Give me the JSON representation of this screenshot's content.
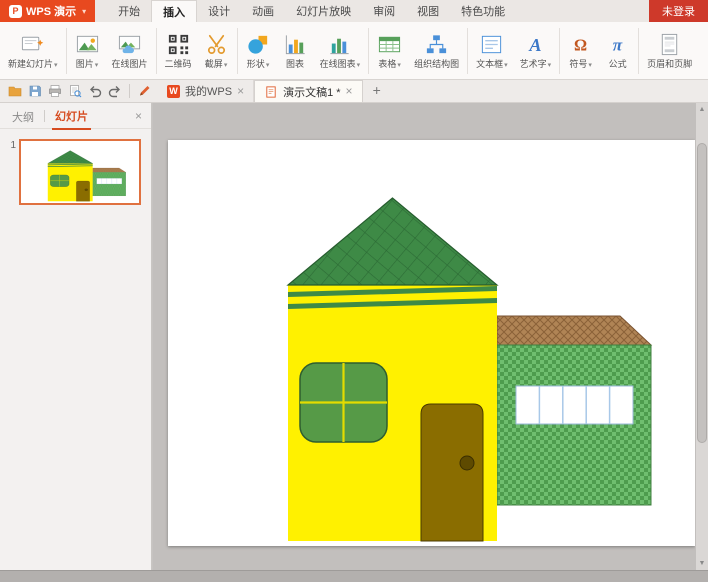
{
  "titlebar": {
    "logo_text": "WPS 演示",
    "login_label": "未登录"
  },
  "icons": {
    "logo_badge": "P",
    "wps_tab_badge": "W",
    "symbol_glyph": "Ω",
    "formula_glyph": "π",
    "wordart_glyph": "A"
  },
  "menu": {
    "active": "插入",
    "items": [
      {
        "label": "开始"
      },
      {
        "label": "插入"
      },
      {
        "label": "设计"
      },
      {
        "label": "动画"
      },
      {
        "label": "幻灯片放映"
      },
      {
        "label": "审阅"
      },
      {
        "label": "视图"
      },
      {
        "label": "特色功能"
      }
    ]
  },
  "ribbon": {
    "buttons": [
      {
        "label": "新建幻灯片",
        "dropdown": true
      },
      {
        "label": "图片",
        "dropdown": true
      },
      {
        "label": "在线图片",
        "dropdown": false
      },
      {
        "label": "二维码",
        "dropdown": false
      },
      {
        "label": "截屏",
        "dropdown": true
      },
      {
        "label": "形状",
        "dropdown": true
      },
      {
        "label": "图表",
        "dropdown": false
      },
      {
        "label": "在线图表",
        "dropdown": true
      },
      {
        "label": "表格",
        "dropdown": true
      },
      {
        "label": "组织结构图",
        "dropdown": false
      },
      {
        "label": "文本框",
        "dropdown": true
      },
      {
        "label": "艺术字",
        "dropdown": true
      },
      {
        "label": "符号",
        "dropdown": true
      },
      {
        "label": "公式",
        "dropdown": false
      },
      {
        "label": "页眉和页脚",
        "dropdown": false
      }
    ]
  },
  "doc_tabs": {
    "tabs": [
      {
        "label": "我的WPS",
        "active": false
      },
      {
        "label": "演示文稿1 *",
        "active": true
      }
    ]
  },
  "sidebar": {
    "outline_label": "大纲",
    "slides_label": "幻灯片",
    "slide_number": "1"
  },
  "colors": {
    "accent": "#e8491f",
    "login_red": "#ce392a",
    "canvas_gray": "#c2bfbd",
    "house_wall_yellow": "#fff100",
    "roof_green": "#3e8a46",
    "window_green": "#569a47",
    "door_brown": "#8a6d00",
    "second_house_green": "#4e9c4e",
    "second_roof_brown": "#b08455",
    "window_pane_blue": "#a8c8e8"
  }
}
